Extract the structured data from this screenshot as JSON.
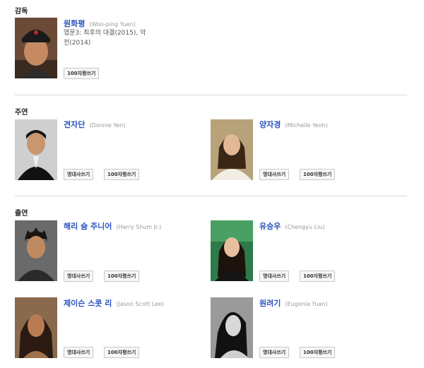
{
  "director_section": {
    "title": "감독",
    "people": [
      {
        "name": "원화평",
        "original_name": "(Woo-ping Yuen)",
        "works": "엽문3: 최후의 대결(2015), 악\n전(2014)",
        "buttons": [
          "100자평쓰기"
        ]
      }
    ]
  },
  "lead_section": {
    "title": "주연",
    "people": [
      {
        "name": "견자단",
        "original_name": "(Donnie Yen)",
        "buttons": [
          "명대사쓰기",
          "100자평쓰기"
        ]
      },
      {
        "name": "양자경",
        "original_name": "(Michelle Yeoh)",
        "buttons": [
          "명대사쓰기",
          "100자평쓰기"
        ]
      }
    ]
  },
  "cast_section": {
    "title": "출연",
    "people": [
      {
        "name": "해리 슘 주니어",
        "original_name": "(Harry Shum Jr.)",
        "buttons": [
          "명대사쓰기",
          "100자평쓰기"
        ]
      },
      {
        "name": "유승우",
        "original_name": "(Chengyu Liu)",
        "buttons": [
          "명대사쓰기",
          "100자평쓰기"
        ]
      },
      {
        "name": "제이슨 스콧 리",
        "original_name": "(Jason Scott Lee)",
        "buttons": [
          "명대사쓰기",
          "100자평쓰기"
        ]
      },
      {
        "name": "원려기",
        "original_name": "(Eugenia Yuan)",
        "buttons": [
          "명대사쓰기",
          "100자평쓰기"
        ]
      }
    ]
  }
}
